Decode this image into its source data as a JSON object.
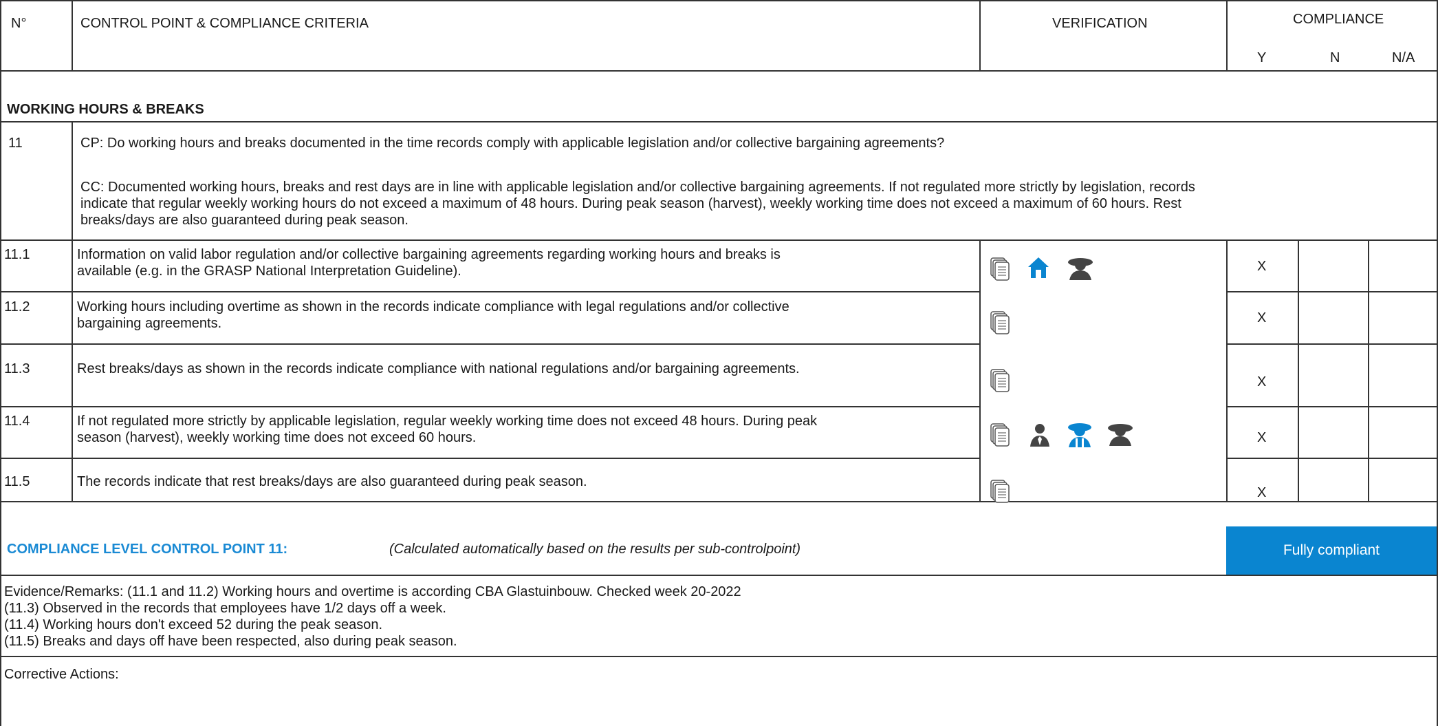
{
  "header": {
    "num_label": "N°",
    "criteria_label": "CONTROL POINT & COMPLIANCE CRITERIA",
    "verification_label": "VERIFICATION",
    "compliance_label": "COMPLIANCE",
    "y_label": "Y",
    "n_label": "N",
    "na_label": "N/A"
  },
  "section": {
    "title": "WORKING HOURS & BREAKS"
  },
  "control_point": {
    "number": "11",
    "cp_text": "CP: Do working hours and breaks documented in the time records comply with applicable legislation and/or collective bargaining agreements?",
    "cc_line1": "CC: Documented working hours, breaks and rest days are in line with applicable legislation and/or collective bargaining agreements. If not regulated more strictly by legislation, records",
    "cc_line2": "indicate that regular weekly working hours do not exceed a maximum of 48 hours. During peak season (harvest), weekly working time does not exceed a maximum of 60 hours. Rest",
    "cc_line3": "breaks/days are also guaranteed during peak season."
  },
  "rows": [
    {
      "num": "11.1",
      "line1": "Information on valid labor regulation and/or collective bargaining agreements regarding working hours and breaks is",
      "line2": "available (e.g. in the GRASP National Interpretation Guideline).",
      "icons": [
        "document-icon",
        "farm-house-icon",
        "worker-icon"
      ],
      "y": "X",
      "n": "",
      "na": ""
    },
    {
      "num": "11.2",
      "line1": "Working hours including overtime as shown in the records indicate compliance with legal regulations and/or collective",
      "line2": "bargaining agreements.",
      "icons": [
        "document-icon"
      ],
      "y": "X",
      "n": "",
      "na": ""
    },
    {
      "num": "11.3",
      "line1": "Rest breaks/days as shown in the records indicate compliance with national regulations and/or bargaining agreements.",
      "line2": "",
      "icons": [
        "document-icon"
      ],
      "y": "X",
      "n": "",
      "na": ""
    },
    {
      "num": "11.4",
      "line1": "If not regulated more strictly by applicable legislation, regular weekly working time does not exceed 48 hours. During peak",
      "line2": "season (harvest), weekly working time does not exceed 60 hours.",
      "icons": [
        "document-icon",
        "manager-icon",
        "worker-representative-icon",
        "worker-icon"
      ],
      "y": "X",
      "n": "",
      "na": ""
    },
    {
      "num": "11.5",
      "line1": "The records indicate that rest breaks/days are also guaranteed during peak season.",
      "line2": "",
      "icons": [
        "document-icon"
      ],
      "y": "X",
      "n": "",
      "na": ""
    }
  ],
  "compliance_level": {
    "label": "COMPLIANCE LEVEL CONTROL POINT 11:",
    "note": "(Calculated automatically based on the results per sub-controlpoint)",
    "status": "Fully compliant"
  },
  "evidence": {
    "line1": "Evidence/Remarks: (11.1 and 11.2) Working hours and overtime is according CBA Glastuinbouw. Checked week 20-2022",
    "line2": "(11.3) Observed in the records that employees have 1/2 days off a week.",
    "line3": "(11.4) Working hours don't exceed 52 during the peak season.",
    "line4": "(11.5) Breaks and days off have been respected, also during peak season."
  },
  "corrective": {
    "label": "Corrective Actions:"
  },
  "colors": {
    "accent": "#1a8ad4",
    "status_fill": "#0a85d0",
    "icon_dark": "#444444"
  }
}
